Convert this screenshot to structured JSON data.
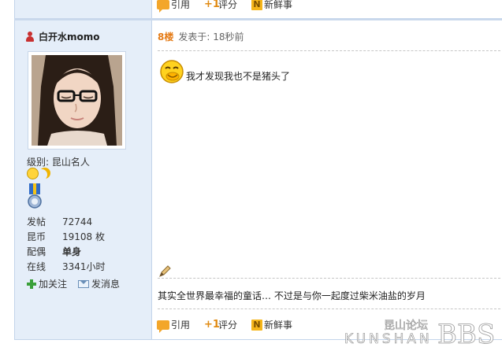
{
  "top_actions": {
    "quote": "引用",
    "rate": "评分",
    "news": "新鲜事"
  },
  "user": {
    "name": "白开水momo",
    "level_label": "级别:",
    "level_value": "昆山名人",
    "stats": [
      {
        "label": "发帖",
        "value": "72744",
        "bold": false
      },
      {
        "label": "昆币",
        "value": "19108 枚",
        "bold": false
      },
      {
        "label": "配偶",
        "value": "单身",
        "bold": true
      },
      {
        "label": "在线",
        "value": "3341小时",
        "bold": false
      }
    ],
    "follow": "加关注",
    "message": "发消息"
  },
  "post": {
    "floor": "8楼",
    "posted": "发表于: 18秒前",
    "text": "我才发现我也不是猪头了",
    "signature": "其实全世界最幸福的童话… 不过是与你一起度过柴米油盐的岁月"
  },
  "bottom_actions": {
    "quote": "引用",
    "rate": "评分",
    "news": "新鲜事"
  },
  "watermark": {
    "cn": "昆山论坛",
    "en": "KUNSHAN",
    "bbs": "BBS"
  },
  "colors": {
    "sidebar_bg": "#e5eef9",
    "floor": "#e57b16",
    "border": "#c3d4ea"
  }
}
